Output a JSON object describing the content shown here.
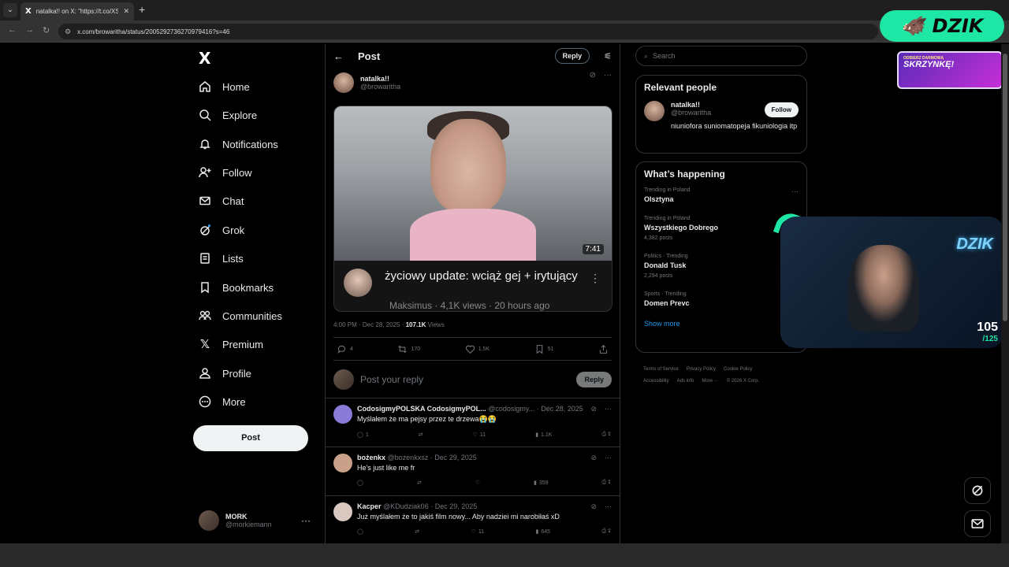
{
  "browser": {
    "tab_title": "natalka!! on X: \"https://t.co/XSz",
    "tab_favicon": "X",
    "new_tab": "+",
    "url": "x.com/browaritha/status/2005292736270979416?s=46"
  },
  "nav": {
    "logo": "X",
    "items": [
      {
        "label": "Home",
        "icon": "home-icon"
      },
      {
        "label": "Explore",
        "icon": "search-icon"
      },
      {
        "label": "Notifications",
        "icon": "bell-icon"
      },
      {
        "label": "Follow",
        "icon": "person-plus-icon"
      },
      {
        "label": "Chat",
        "icon": "envelope-icon"
      },
      {
        "label": "Grok",
        "icon": "grok-icon"
      },
      {
        "label": "Lists",
        "icon": "list-icon"
      },
      {
        "label": "Bookmarks",
        "icon": "bookmark-icon"
      },
      {
        "label": "Communities",
        "icon": "people-icon"
      },
      {
        "label": "Premium",
        "icon": "x-icon"
      },
      {
        "label": "Profile",
        "icon": "person-icon"
      },
      {
        "label": "More",
        "icon": "more-circle-icon"
      }
    ],
    "post_button": "Post",
    "account": {
      "name": "MORK",
      "handle": "@morkiemann",
      "more": "···"
    }
  },
  "post": {
    "header_title": "Post",
    "header_reply": "Reply",
    "author_name": "natalka!!",
    "author_handle": "@browaritha",
    "media": {
      "duration": "7:41",
      "title": "życiowy update: wciąż gej + irytujący",
      "meta": "Maksimus · 4,1K views · 20 hours ago"
    },
    "time": "4:00 PM · Dec 28, 2025 · ",
    "views": "107.1K",
    "views_label": " Views",
    "stats": {
      "replies": "4",
      "reposts": "170",
      "likes": "1.5K",
      "bookmarks": "51"
    },
    "reply_placeholder": "Post your reply",
    "reply_button": "Reply"
  },
  "replies": [
    {
      "name": "CodosigmyPOLSKA CodosigmyPOL...",
      "handle": "@codosigmy...",
      "date": "Dec 28, 2025",
      "text": "Myślałem że ma pejsy przez te drzewa😭😭",
      "replies": "1",
      "reposts": "",
      "likes": "11",
      "views": "1.1K",
      "avatar_color": "#8b7bd8"
    },
    {
      "name": "bożenkx",
      "handle": "@bozenkxsz",
      "date": "Dec 29, 2025",
      "text": "He's just like me fr",
      "replies": "",
      "reposts": "",
      "likes": "",
      "views": "359",
      "avatar_color": "#c9a089"
    },
    {
      "name": "Kacper",
      "handle": "@KDudziak06",
      "date": "Dec 29, 2025",
      "text": "Już myślałem że to jakiś film nowy... Aby nadziei mi narobiłaś xD",
      "replies": "",
      "reposts": "",
      "likes": "11",
      "views": "645",
      "avatar_color": "#d8c8c0"
    }
  ],
  "right": {
    "search_placeholder": "Search",
    "relevant_title": "Relevant people",
    "person": {
      "name": "natalka!!",
      "handle": "@browaritha",
      "bio": "niuniofora suniomatopeja fikuniologia itp",
      "follow": "Follow"
    },
    "happening_title": "What’s happening",
    "trends": [
      {
        "ctx": "Trending in Poland",
        "title": "Olsztyna",
        "count": ""
      },
      {
        "ctx": "Trending in Poland",
        "title": "Wszystkiego Dobrego",
        "count": "4,382 posts"
      },
      {
        "ctx": "Politics · Trending",
        "title": "Donald Tusk",
        "count": "2,294 posts"
      },
      {
        "ctx": "Sports · Trending",
        "title": "Domen Prevc",
        "count": ""
      }
    ],
    "show_more": "Show more",
    "footer": [
      "Terms of Service",
      "Privacy Policy",
      "Cookie Policy",
      "Accessibility",
      "Ads info",
      "More ···",
      "© 2026 X Corp."
    ]
  },
  "overlay": {
    "brand": "DZIK",
    "promo_small": "ODBIERZ DARMOWĄ",
    "promo_big": "SKRZYNKĘ!",
    "webcam_neon": "DZIK",
    "counter_value": "105",
    "counter_total": "/125"
  },
  "colors": {
    "accent": "#1d9bf0",
    "brand": "#1ee6a5"
  }
}
